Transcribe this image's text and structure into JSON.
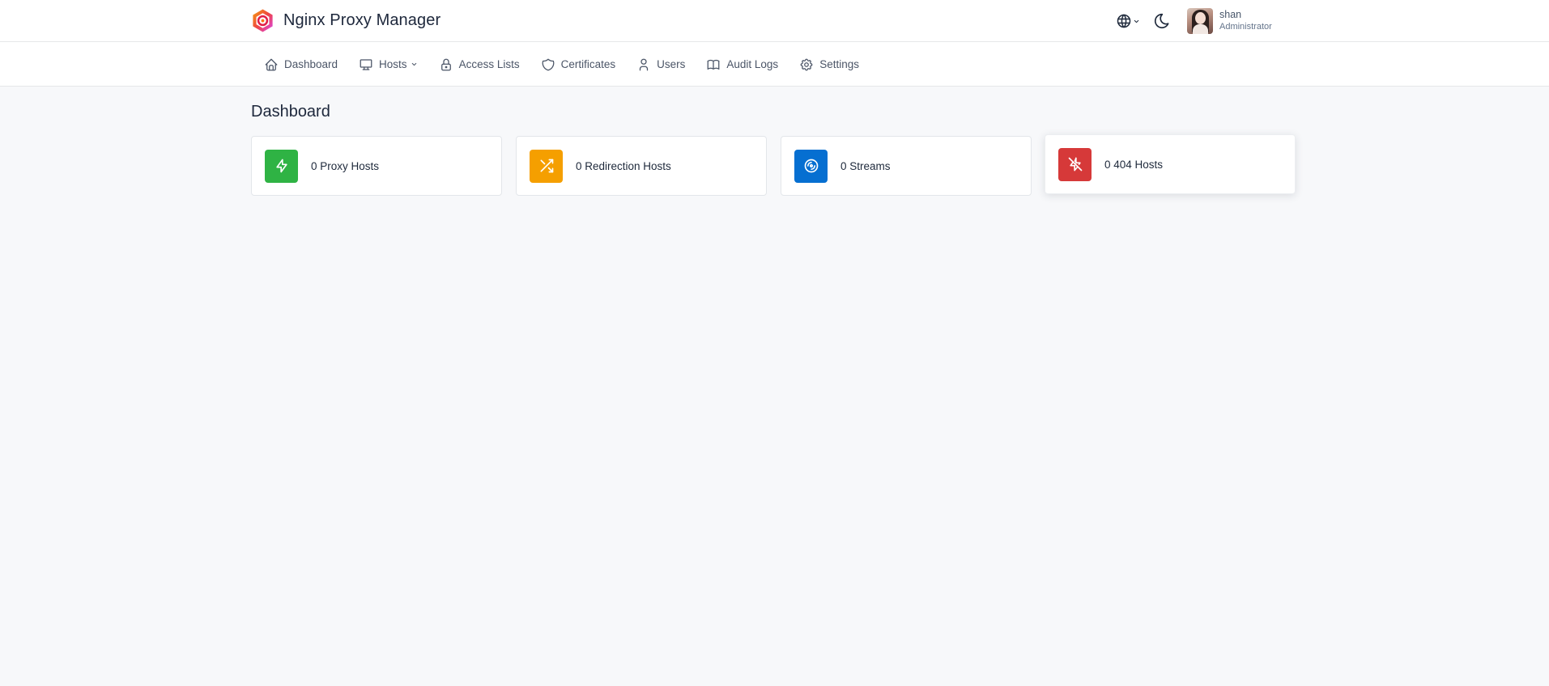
{
  "app": {
    "title": "Nginx Proxy Manager",
    "logo_icon": "nginx-proxy-manager-logo-icon"
  },
  "header": {
    "language_icon": "globe-icon",
    "theme_icon": "moon-icon",
    "user": {
      "name": "shan",
      "role": "Administrator",
      "avatar_icon": "user-avatar"
    }
  },
  "nav": {
    "items": [
      {
        "label": "Dashboard",
        "icon": "home-icon"
      },
      {
        "label": "Hosts",
        "icon": "monitor-icon",
        "has_dropdown": true
      },
      {
        "label": "Access Lists",
        "icon": "lock-icon"
      },
      {
        "label": "Certificates",
        "icon": "shield-icon"
      },
      {
        "label": "Users",
        "icon": "user-icon"
      },
      {
        "label": "Audit Logs",
        "icon": "book-icon"
      },
      {
        "label": "Settings",
        "icon": "gear-icon"
      }
    ]
  },
  "main": {
    "page_title": "Dashboard",
    "cards": [
      {
        "label": "0 Proxy Hosts",
        "icon": "bolt-icon",
        "color": "#2fb344"
      },
      {
        "label": "0 Redirection Hosts",
        "icon": "shuffle-icon",
        "color": "#f59f00"
      },
      {
        "label": "0 Streams",
        "icon": "disc-icon",
        "color": "#066fd1"
      },
      {
        "label": "0 404 Hosts",
        "icon": "bolt-off-icon",
        "color": "#d63939"
      }
    ]
  },
  "colors": {
    "background": "#f7f8fa",
    "surface": "#ffffff",
    "border": "#e6e7e9",
    "text": "#1d273b",
    "muted_text": "#4b5567"
  }
}
